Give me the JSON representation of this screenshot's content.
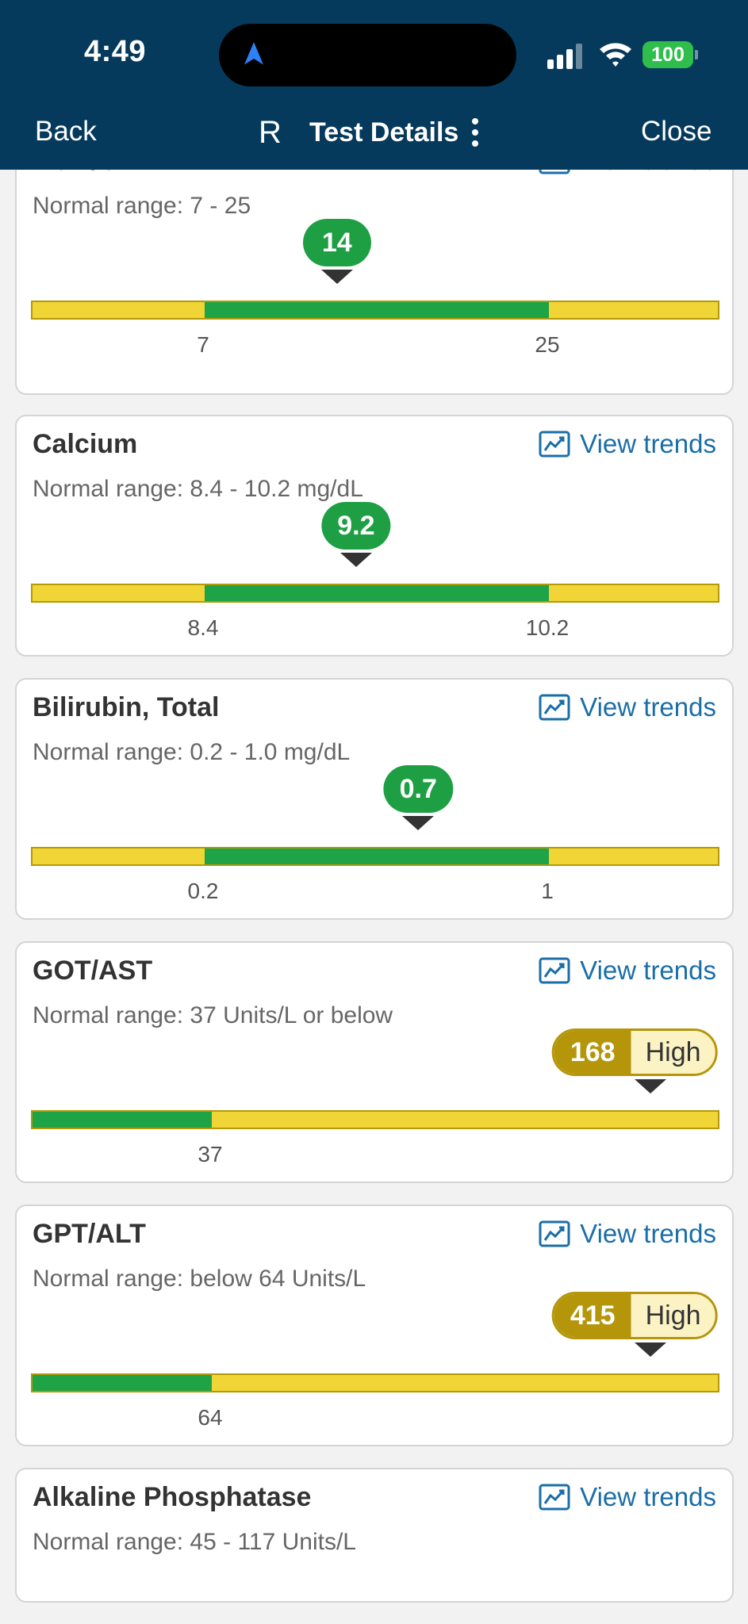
{
  "status_bar": {
    "time": "4:49",
    "battery": "100"
  },
  "header": {
    "back": "Back",
    "avatar": "R",
    "title": "Test Details",
    "close": "Close"
  },
  "view_trends_label": "View trends",
  "colors": {
    "header_bg": "#053a5c",
    "in_range": "#1ea347",
    "out_of_range": "#f1d435",
    "high_badge": "#b5960b",
    "link": "#1a6ea8"
  },
  "tests": [
    {
      "name": "BUN/Cr",
      "range_text": "Normal range: 7 - 25",
      "value": "14",
      "value_num": 14,
      "flag": "",
      "low_label": "7",
      "high_label": "25",
      "low_num": 7,
      "high_num": 25
    },
    {
      "name": "Calcium",
      "range_text": "Normal range: 8.4 - 10.2 mg/dL",
      "value": "9.2",
      "value_num": 9.2,
      "flag": "",
      "low_label": "8.4",
      "high_label": "10.2",
      "low_num": 8.4,
      "high_num": 10.2
    },
    {
      "name": "Bilirubin, Total",
      "range_text": "Normal range: 0.2 - 1.0 mg/dL",
      "value": "0.7",
      "value_num": 0.7,
      "flag": "",
      "low_label": "0.2",
      "high_label": "1",
      "low_num": 0.2,
      "high_num": 1.0
    },
    {
      "name": "GOT/AST",
      "range_text": "Normal range: 37 Units/L or below",
      "value": "168",
      "value_num": 168,
      "flag": "High",
      "low_label": "",
      "high_label": "37",
      "low_num": null,
      "high_num": 37
    },
    {
      "name": "GPT/ALT",
      "range_text": "Normal range: below 64 Units/L",
      "value": "415",
      "value_num": 415,
      "flag": "High",
      "low_label": "",
      "high_label": "64",
      "low_num": null,
      "high_num": 64
    },
    {
      "name": "Alkaline Phosphatase",
      "range_text": "Normal range: 45 - 117 Units/L"
    }
  ]
}
